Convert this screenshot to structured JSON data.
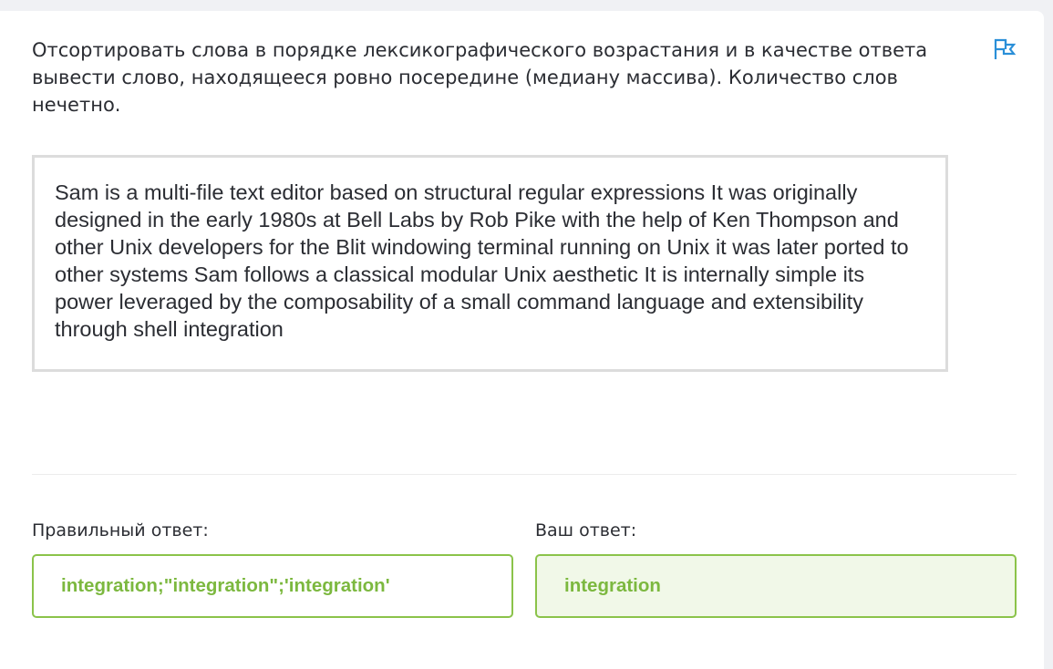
{
  "task": {
    "description": "Отсортировать слова в порядке лексикографического возрастания и в качестве ответа вывести слово, находящееся ровно посередине (медиану массива). Количество слов нечетно.",
    "source_text": "Sam is a multi-file text editor based on structural regular expressions It was originally designed in the early 1980s at Bell Labs by Rob Pike with the help of Ken Thompson and other Unix developers for the Blit windowing terminal running on Unix it was later ported to other systems Sam follows a classical modular Unix aesthetic It is internally simple its power leveraged by the composability of a small command language and extensibility through shell integration",
    "flag_icon": "flag-icon"
  },
  "answers": {
    "correct_label": "Правильный ответ:",
    "correct_value": "integration;\"integration\";'integration'",
    "yours_label": "Ваш ответ:",
    "yours_value": "integration"
  },
  "colors": {
    "accent_blue": "#2a8fd8",
    "success_green": "#7cb83f",
    "success_border": "#8bc34a",
    "success_bg": "#f1f8e8"
  }
}
